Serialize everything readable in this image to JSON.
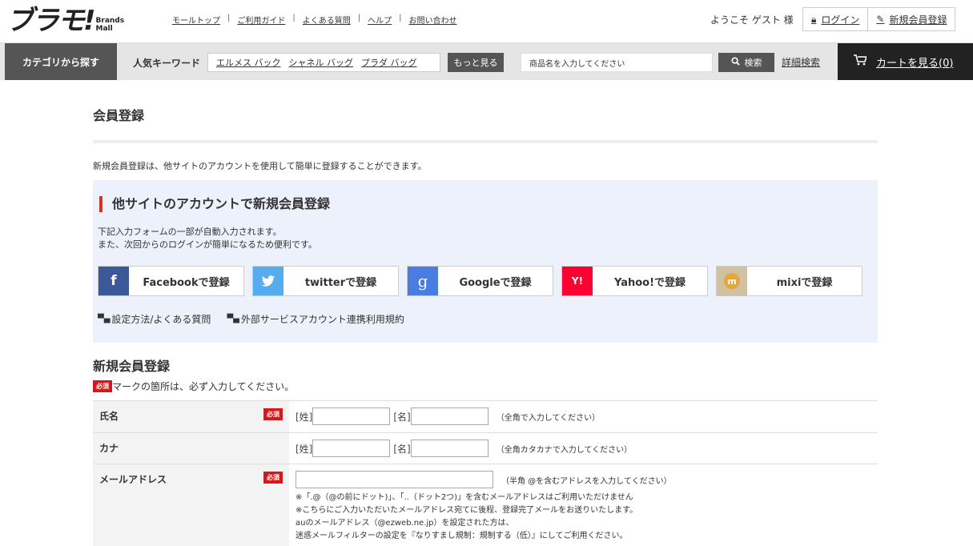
{
  "header": {
    "logo_main": "ブラモ!",
    "logo_sub_1": "Brands",
    "logo_sub_2": "Mall",
    "links": [
      "モールトップ",
      "ご利用ガイド",
      "よくある質問",
      "ヘルプ",
      "お問い合わせ"
    ],
    "welcome": "ようこそ ゲスト 様",
    "login": "ログイン",
    "register": "新規会員登録"
  },
  "navbar": {
    "category": "カテゴリから探す",
    "keyword_label": "人気キーワード",
    "keywords": [
      "エルメス バック",
      "シャネル バッグ",
      "プラダ バッグ"
    ],
    "more": "もっと見る",
    "search_placeholder": "商品名を入力してください",
    "search_button": "検索",
    "advanced": "詳細検索",
    "cart": "カートを見る(0)"
  },
  "page": {
    "title": "会員登録",
    "intro": "新規会員登録は、他サイトのアカウントを使用して簡単に登録することができます。"
  },
  "social": {
    "heading": "他サイトのアカウントで新規会員登録",
    "desc_1": "下記入力フォームの一部が自動入力されます。",
    "desc_2": "また、次回からのログインが簡単になるため便利です。",
    "buttons": [
      {
        "label": "Facebookで登録",
        "icon": "facebook-icon",
        "color": "#3b5998"
      },
      {
        "label": "twitterで登録",
        "icon": "twitter-icon",
        "color": "#55acee"
      },
      {
        "label": "Googleで登録",
        "icon": "google-icon",
        "color": "#4a7de2"
      },
      {
        "label": "Yahoo!で登録",
        "icon": "yahoo-icon",
        "color": "#ff0033"
      },
      {
        "label": "mixiで登録",
        "icon": "mixi-icon",
        "color": "#d1c1a0"
      }
    ],
    "link_1": "設定方法/よくある質問",
    "link_2": "外部サービスアカウント連携利用規約"
  },
  "form": {
    "heading": "新規会員登録",
    "required_badge": "必須",
    "required_note": "マークの箇所は、必ず入力してください。",
    "name_label": "氏名",
    "kana_label": "カナ",
    "mail_label": "メールアドレス",
    "sei": "[姓]",
    "mei": "[名]",
    "name_hint": "（全角で入力してください）",
    "kana_hint": "（全角カタカナで入力してください）",
    "mail_hint": "（半角 @を含むアドレスを入力してください）",
    "mail_note_1": "※「.@（@の前にドット)」、「..（ドット2つ)」を含むメールアドレスはご利用いただけません",
    "mail_note_2": "※こちらにご入力いただいたメールアドレス宛てに後程、登録完了メールをお送りいたします。",
    "mail_note_3": "auのメールアドレス（@ezweb.ne.jp）を設定された方は、",
    "mail_note_4": "迷惑メールフィルターの設定を『なりすまし規制：規制する（低）』にしてご利用ください。"
  }
}
